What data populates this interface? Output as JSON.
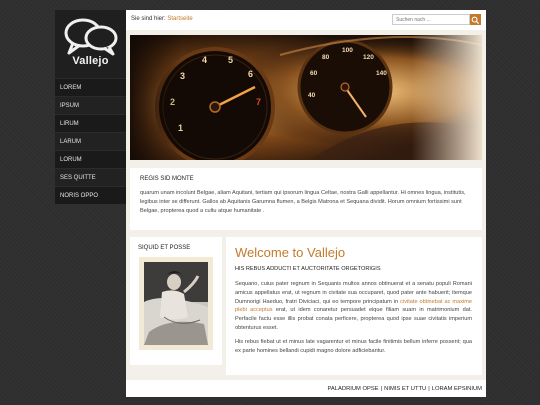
{
  "brand": {
    "name": "Vallejo"
  },
  "nav": [
    {
      "label": "LOREM"
    },
    {
      "label": "IPSUM"
    },
    {
      "label": "LIRUM"
    },
    {
      "label": "LARUM"
    },
    {
      "label": "LORUM"
    },
    {
      "label": "SES QUITTE"
    },
    {
      "label": "NORIS OPPO"
    }
  ],
  "breadcrumb": {
    "prefix": "Sie sind hier:",
    "link": "Startseite"
  },
  "search": {
    "placeholder": "Suchen nach ..."
  },
  "intro": {
    "title": "REGIS SID MONTE",
    "text": "quarum unam incolunt Belgae, aliam Aquitani, tertiam qui ipsorum lingua Celtae, nostra Galli appellantur. Hi omnes lingua, institutis, legibus inter se differunt. Gallos ab Aquitanis Garumna flumen, a Belgis Matrona et Sequana dividit. Horum omnium fortissimi sunt Belgae, propterea quod a cultu atque humanitate ."
  },
  "side_box": {
    "title": "SIQUID ET POSSE"
  },
  "content": {
    "title": "Welcome to Vallejo",
    "subtitle": "HIS REBUS ADDUCTI ET AUCTORITATE ORGETORIGIS",
    "p1_before": "Sequano, cuius pater regnum in Sequanis multos annos obtinuerat et a senatu populi Romani amicus appellatus erat, ut regnum in civitate sua occuparet, quod pater ante habuerit; itemque Dumnorigi Haeduo, fratri Diviciaci, qui eo tempore principatum in ",
    "p1_highlight": "civitate obtinebat ac maxime plebi acceptus",
    "p1_after": " erat, ut idem conaretur persuadet eique filiam suam in matrimonium dat. Perfacile factu esse illis probat conata perficere, propterea quod ipse suae civitatis imperium obtenturus esset.",
    "p2": "His rebus fiebat ut et minus late vagarentur et minus facile finitimis bellum inferre possent; qua ex parte homines bellandi cupidi magno dolore adficiebantur."
  },
  "footer": {
    "links": [
      "PALADRIUM OPSE",
      "NIMIS ET UTTU",
      "LORAM EPSINIUM"
    ],
    "separator": "|"
  },
  "colors": {
    "accent": "#c27a2c",
    "sidebar": "#1f1f1f",
    "page_bg": "#2e2e2e",
    "panel_bg": "#f3f0ea"
  },
  "icons": {
    "logo": "speech-bubbles-icon",
    "search": "search-icon"
  }
}
